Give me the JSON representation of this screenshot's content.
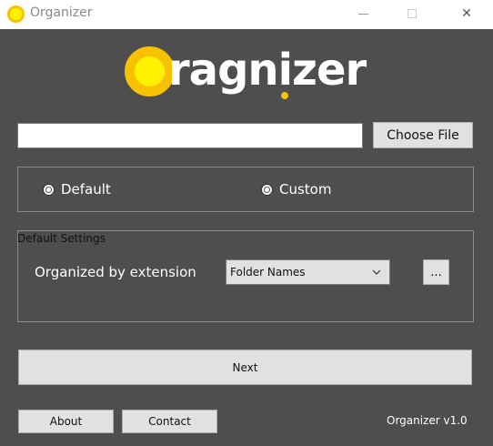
{
  "window": {
    "title": "Organizer",
    "app_icon": "sun-icon",
    "controls": {
      "minimize_icon": "minimize-icon",
      "maximize_icon": "maximize-icon",
      "close_icon": "close-icon",
      "close_glyph": "✕"
    }
  },
  "logo": {
    "text": "ragnizer",
    "mark_icon": "sun-ring-icon",
    "colors": {
      "ring": "#f8c200",
      "core": "#fff200",
      "text": "#ffffff"
    }
  },
  "file_picker": {
    "value": "",
    "button_label": "Choose File"
  },
  "mode": {
    "options": [
      {
        "label": "Default",
        "selected": false
      },
      {
        "label": "Custom",
        "selected": false
      }
    ]
  },
  "default_settings": {
    "legend": "Default Settings",
    "organize_label": "Organized by extension",
    "folder_select": {
      "selected": "Folder Names",
      "chevron_icon": "chevron-down-icon"
    },
    "more_button_label": "..."
  },
  "actions": {
    "next_label": "Next",
    "about_label": "About",
    "contact_label": "Contact"
  },
  "version": "Organizer v1.0",
  "theme": {
    "background": "#4e4e4e",
    "button": "#e1e1e1"
  }
}
